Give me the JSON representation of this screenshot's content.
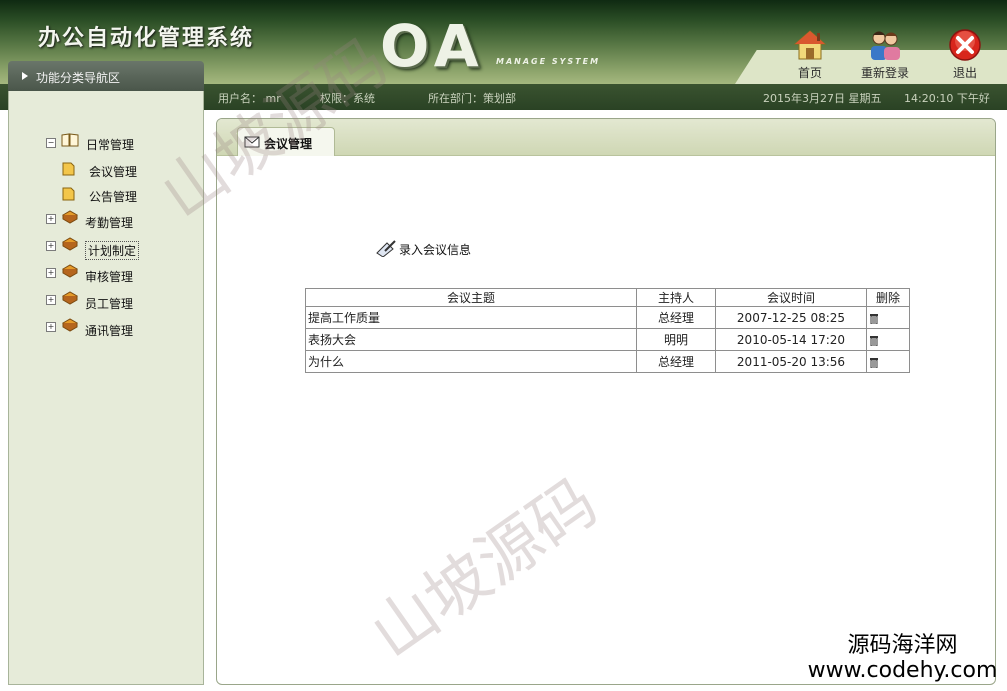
{
  "app": {
    "title": "办公自动化管理系统",
    "logo_main": "OA",
    "logo_sub": "MANAGE SYSTEM"
  },
  "top_buttons": [
    {
      "label": "首页",
      "icon": "home-icon"
    },
    {
      "label": "重新登录",
      "icon": "users-icon"
    },
    {
      "label": "退出",
      "icon": "exit-icon"
    }
  ],
  "infobar": {
    "user": "用户名： mr",
    "role": "权限：系统",
    "dept": "所在部门：策划部",
    "date": "2015年3月27日 星期五",
    "time": "14:20:10 下午好"
  },
  "sidebar": {
    "header": "功能分类导航区",
    "items": [
      {
        "label": "日常管理",
        "expander": "⊟",
        "icon": "book-open-icon"
      },
      {
        "label": "会议管理",
        "icon": "folder-icon"
      },
      {
        "label": "公告管理",
        "icon": "folder-icon"
      },
      {
        "label": "考勤管理",
        "expander": "⊞",
        "icon": "books-icon"
      },
      {
        "label": "计划制定",
        "expander": "⊞",
        "icon": "books-icon"
      },
      {
        "label": "审核管理",
        "expander": "⊞",
        "icon": "books-icon"
      },
      {
        "label": "员工管理",
        "expander": "⊞",
        "icon": "books-icon"
      },
      {
        "label": "通讯管理",
        "expander": "⊞",
        "icon": "books-icon"
      }
    ]
  },
  "main": {
    "tab_label": "会议管理",
    "add_link": "录入会议信息",
    "table": {
      "headers": [
        "会议主题",
        "主持人",
        "会议时间",
        "删除"
      ],
      "rows": [
        {
          "topic": "提高工作质量",
          "host": "总经理",
          "time": "2007-12-25 08:25"
        },
        {
          "topic": "表扬大会",
          "host": "明明",
          "time": "2010-05-14 17:20"
        },
        {
          "topic": "为什么",
          "host": "总经理",
          "time": "2011-05-20 13:56"
        }
      ]
    }
  },
  "watermarks": {
    "text": "山坡源码",
    "corner_line1": "源码海洋网",
    "corner_line2": "www.codehy.com"
  }
}
